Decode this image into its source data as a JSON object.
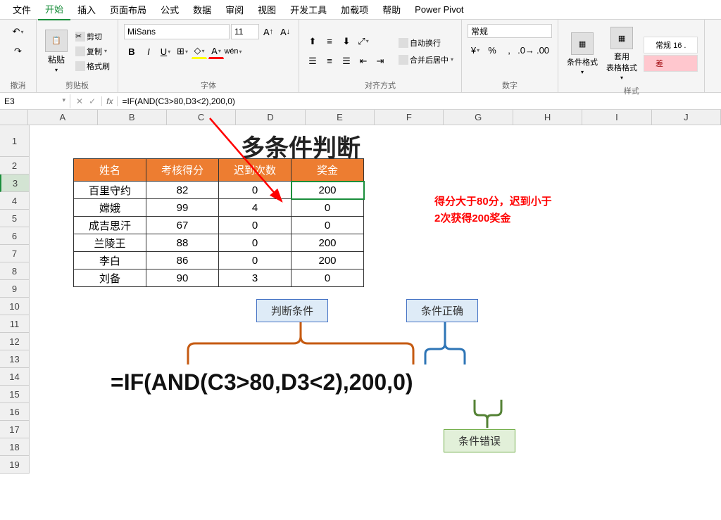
{
  "menu": {
    "items": [
      "文件",
      "开始",
      "插入",
      "页面布局",
      "公式",
      "数据",
      "审阅",
      "视图",
      "开发工具",
      "加载项",
      "帮助",
      "Power Pivot"
    ],
    "active_index": 1
  },
  "ribbon": {
    "undo": {
      "label": "撤消"
    },
    "clipboard": {
      "cut": "剪切",
      "copy": "复制",
      "paste": "粘贴",
      "format_painter": "格式刷",
      "label": "剪贴板"
    },
    "font": {
      "family": "MiSans",
      "size": "11",
      "label": "字体"
    },
    "alignment": {
      "wrap": "自动换行",
      "merge": "合并后居中",
      "label": "对齐方式"
    },
    "number": {
      "format": "常规",
      "label": "数字"
    },
    "styles": {
      "cond_format": "条件格式",
      "as_table": "套用\n表格格式",
      "normal": "常规 16 .",
      "bad": "差",
      "label": "样式"
    }
  },
  "formula_bar": {
    "name_box": "E3",
    "formula": "=IF(AND(C3>80,D3<2),200,0)"
  },
  "columns": [
    "A",
    "B",
    "C",
    "D",
    "E",
    "F",
    "G",
    "H",
    "I",
    "J"
  ],
  "row_numbers": [
    "1",
    "2",
    "3",
    "4",
    "5",
    "6",
    "7",
    "8",
    "9",
    "10",
    "11",
    "12",
    "13",
    "14",
    "15",
    "16",
    "17",
    "18",
    "19"
  ],
  "sheet": {
    "title": "多条件判断",
    "headers": [
      "姓名",
      "考核得分",
      "迟到次数",
      "奖金"
    ],
    "rows": [
      {
        "name": "百里守约",
        "score": "82",
        "late": "0",
        "bonus": "200"
      },
      {
        "name": "嫦娥",
        "score": "99",
        "late": "4",
        "bonus": "0"
      },
      {
        "name": "成吉思汗",
        "score": "67",
        "late": "0",
        "bonus": "0"
      },
      {
        "name": "兰陵王",
        "score": "88",
        "late": "0",
        "bonus": "200"
      },
      {
        "name": "李白",
        "score": "86",
        "late": "0",
        "bonus": "200"
      },
      {
        "name": "刘备",
        "score": "90",
        "late": "3",
        "bonus": "0"
      }
    ],
    "note_line1": "得分大于80分，迟到小于",
    "note_line2": "2次获得200奖金",
    "anno1": "判断条件",
    "anno2": "条件正确",
    "anno3": "条件错误",
    "big_formula": "=IF(AND(C3>80,D3<2),200,0)"
  }
}
